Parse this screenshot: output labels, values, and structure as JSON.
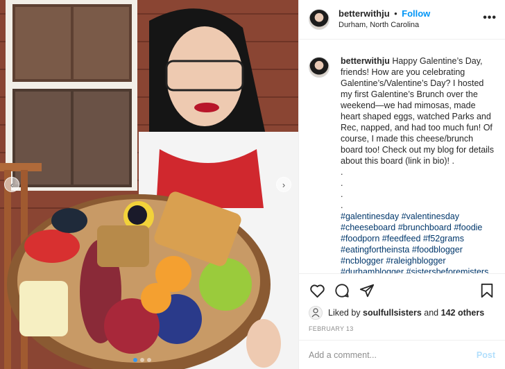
{
  "post": {
    "username": "betterwithju",
    "separator": "•",
    "follow_label": "Follow",
    "location": "Durham, North Carolina",
    "more_icon": "more-options-icon",
    "caption_text": "Happy Galentine’s Day, friends! How are you celebrating Galentine’s/Valentine’s Day? I hosted my first Galentine’s Brunch over the weekend—we had mimosas, made heart shaped eggs, watched Parks and Rec, napped, and had too much fun! Of course, I made this cheese/brunch board too! Check out my blog for details about this board (link in bio)! .",
    "dots": [
      ".",
      ".",
      ".",
      "."
    ],
    "hashtags": [
      "#galentinesday",
      "#valentinesday",
      "#cheeseboard",
      "#brunchboard",
      "#foodie",
      "#foodporn",
      "#feedfeed",
      "#f52grams",
      "#eatingfortheinsta",
      "#foodblogger",
      "#ncblogger",
      "#raleighblogger",
      "#durhamblogger",
      "#sistersbeforemisters"
    ],
    "liked_by_prefix": "Liked by",
    "liked_by_user": "soulfullsisters",
    "liked_by_and": "and",
    "likes_count": "142 others",
    "date": "FEBRUARY 13",
    "comment_placeholder": "Add a comment...",
    "post_label": "Post"
  },
  "carousel": {
    "prev_icon": "chevron-left-icon",
    "next_icon": "chevron-right-icon",
    "slide_count": 3,
    "active_slide": 1
  },
  "colors": {
    "link_blue": "#0095f6",
    "hashtag": "#00376b",
    "post_disabled": "#b2dffc"
  }
}
